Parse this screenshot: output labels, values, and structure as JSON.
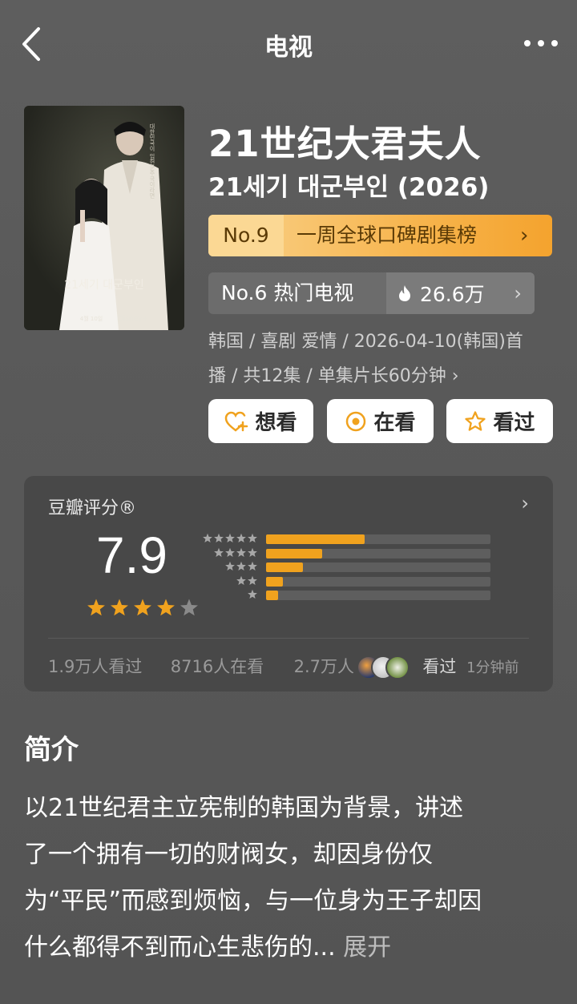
{
  "header": {
    "title": "电视"
  },
  "poster": {
    "tagline": "대한민국이 입헌군주국이라면",
    "title_art": "21세기 대군부인",
    "date_text": "4월 10일",
    "platform": "Disney+"
  },
  "show": {
    "title": "21世纪大君夫人",
    "subtitle": "21세기 대군부인 (2026)",
    "rank": {
      "number": "No.9",
      "name": "一周全球口碑剧集榜"
    },
    "hot": {
      "label": "No.6 热门电视",
      "count": "26.6万"
    },
    "meta_line1": "韩国 / 喜剧 爱情 / 2026-04-10(韩国)首",
    "meta_line2": "播 / 共12集 / 单集片长60分钟 ›"
  },
  "actions": {
    "want": "想看",
    "watching": "在看",
    "watched": "看过"
  },
  "rating": {
    "title": "豆瓣评分®",
    "score": "7.9",
    "stars_filled": 4,
    "stars_total": 5,
    "distribution": [
      {
        "stars": 5,
        "fraction": 0.44
      },
      {
        "stars": 4,
        "fraction": 0.25
      },
      {
        "stars": 3,
        "fraction": 0.165
      },
      {
        "stars": 2,
        "fraction": 0.075
      },
      {
        "stars": 1,
        "fraction": 0.055
      }
    ],
    "footer": {
      "watched_count": "1.9万人看过",
      "watching_count": "8716人在看",
      "want_count": "2.7万人",
      "recent_action": "看过",
      "time_ago": "1分钟前"
    }
  },
  "intro": {
    "title": "简介",
    "line1": "以21世纪君主立宪制的韩国为背景，讲述",
    "line2": "了一个拥有一切的财阀女，却因身份仅",
    "line3": "为“平民”而感到烦恼，与一位身为王子却因",
    "line4": "什么都得不到而心生悲伤的...",
    "expand": "展开"
  },
  "colors": {
    "accent": "#f0a21e",
    "badge_gold": "#f7b54e",
    "card_bg": "#484848",
    "page_bg": "#5a5a5a"
  },
  "icons": {
    "back": "chevron-left-icon",
    "more": "more-dots-icon",
    "fire": "fire-icon",
    "want": "heart-plus-icon",
    "watching": "target-circle-icon",
    "watched": "star-outline-icon"
  }
}
